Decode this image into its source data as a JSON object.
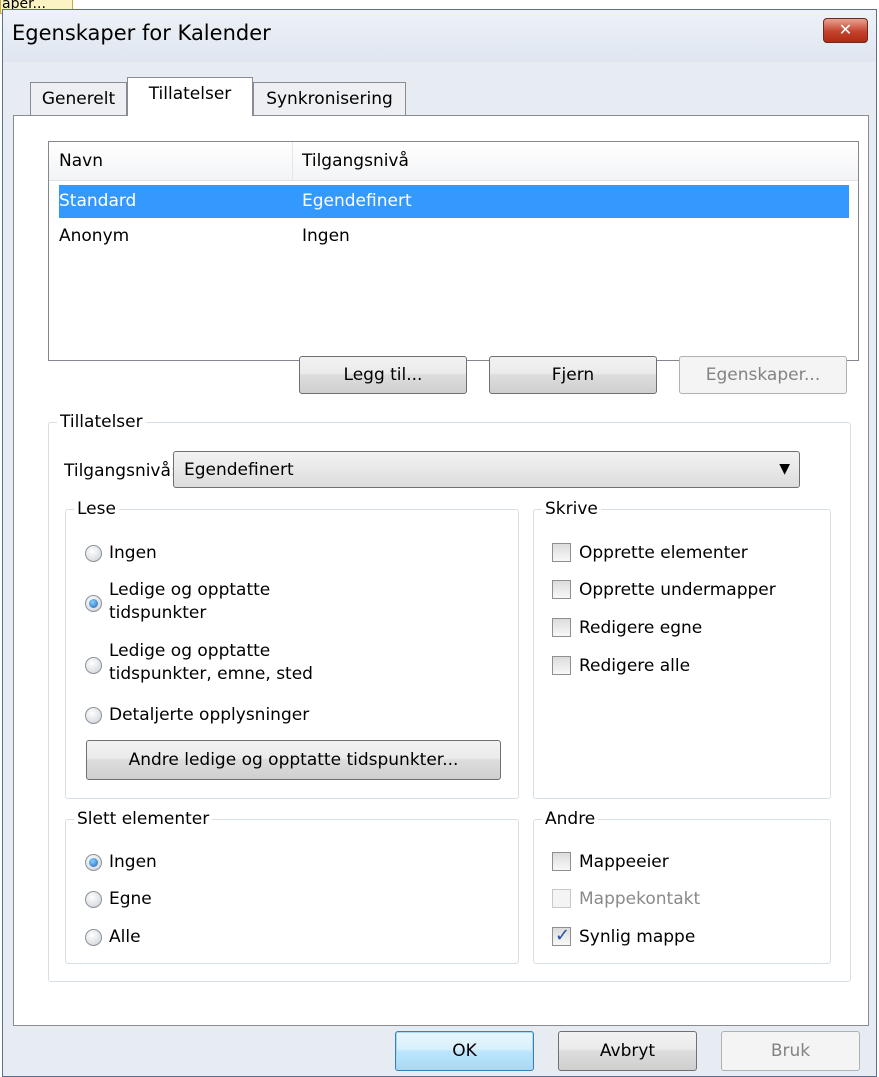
{
  "tooltip": "aper...",
  "window": {
    "title": "Egenskaper for Kalender",
    "close_glyph": "✕"
  },
  "tabs": [
    {
      "label": "Generelt",
      "active": false
    },
    {
      "label": "Tillatelser",
      "active": true
    },
    {
      "label": "Synkronisering",
      "active": false
    }
  ],
  "perm_list": {
    "headers": [
      "Navn",
      "Tilgangsnivå"
    ],
    "rows": [
      {
        "name": "Standard",
        "level": "Egendefinert",
        "selected": true
      },
      {
        "name": "Anonym",
        "level": "Ingen",
        "selected": false
      }
    ]
  },
  "list_buttons": {
    "add": "Legg til...",
    "remove": "Fjern",
    "properties": "Egenskaper..."
  },
  "permissions": {
    "group_title": "Tillatelser",
    "access_label": "Tilgangsnivå:",
    "access_value": "Egendefinert",
    "read": {
      "title": "Lese",
      "options": [
        {
          "label": "Ingen",
          "checked": false
        },
        {
          "label_line1": "Ledige og opptatte",
          "label_line2": "tidspunkter",
          "checked": true
        },
        {
          "label_line1": "Ledige og opptatte",
          "label_line2": "tidspunkter, emne, sted",
          "checked": false
        },
        {
          "label": "Detaljerte opplysninger",
          "checked": false
        }
      ],
      "other_button": "Andre ledige og opptatte tidspunkter..."
    },
    "write": {
      "title": "Skrive",
      "options": [
        {
          "label": "Opprette elementer",
          "checked": false
        },
        {
          "label": "Opprette undermapper",
          "checked": false
        },
        {
          "label": "Redigere egne",
          "checked": false
        },
        {
          "label": "Redigere alle",
          "checked": false
        }
      ]
    },
    "delete": {
      "title": "Slett elementer",
      "options": [
        {
          "label": "Ingen",
          "checked": true
        },
        {
          "label": "Egne",
          "checked": false
        },
        {
          "label": "Alle",
          "checked": false
        }
      ]
    },
    "other": {
      "title": "Andre",
      "options": [
        {
          "label": "Mappeeier",
          "checked": false,
          "disabled": false
        },
        {
          "label": "Mappekontakt",
          "checked": false,
          "disabled": true
        },
        {
          "label": "Synlig mappe",
          "checked": true,
          "disabled": false
        }
      ]
    }
  },
  "footer_buttons": {
    "ok": "OK",
    "cancel": "Avbryt",
    "apply": "Bruk"
  }
}
